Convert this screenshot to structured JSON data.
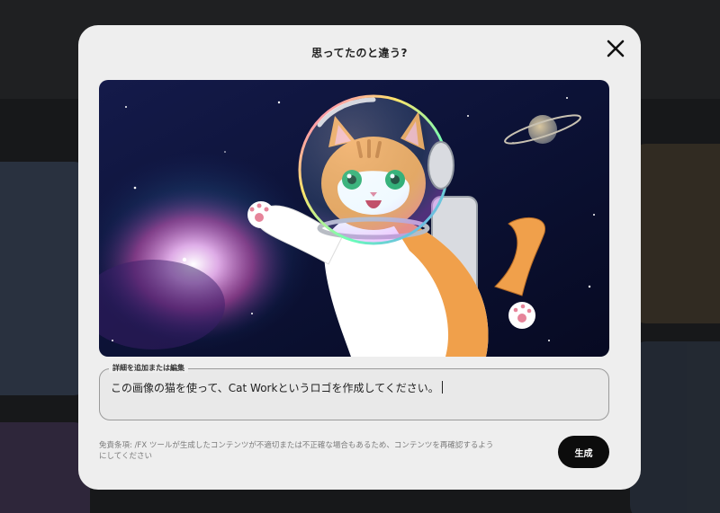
{
  "dialog": {
    "title": "思ってたのと違う?",
    "close_icon": "close-icon"
  },
  "image": {
    "subject": "cat-astronaut-illustration",
    "colors": {
      "space": "#0b0d2a",
      "nebula": "#d86bd6",
      "fur": "#f0a04b"
    }
  },
  "prompt": {
    "label": "詳細を追加または編集",
    "value": "この画像の猫を使って、Cat Workというロゴを作成してください。"
  },
  "disclaimer": "免責条項: /FX ツールが生成したコンテンツが不適切または不正確な場合もあるため、コンテンツを再確認するようにしてください",
  "actions": {
    "generate_label": "生成"
  },
  "theme": {
    "modal_bg": "#eeeeee",
    "button_bg": "#0c0c0c",
    "button_text": "#ffffff"
  }
}
